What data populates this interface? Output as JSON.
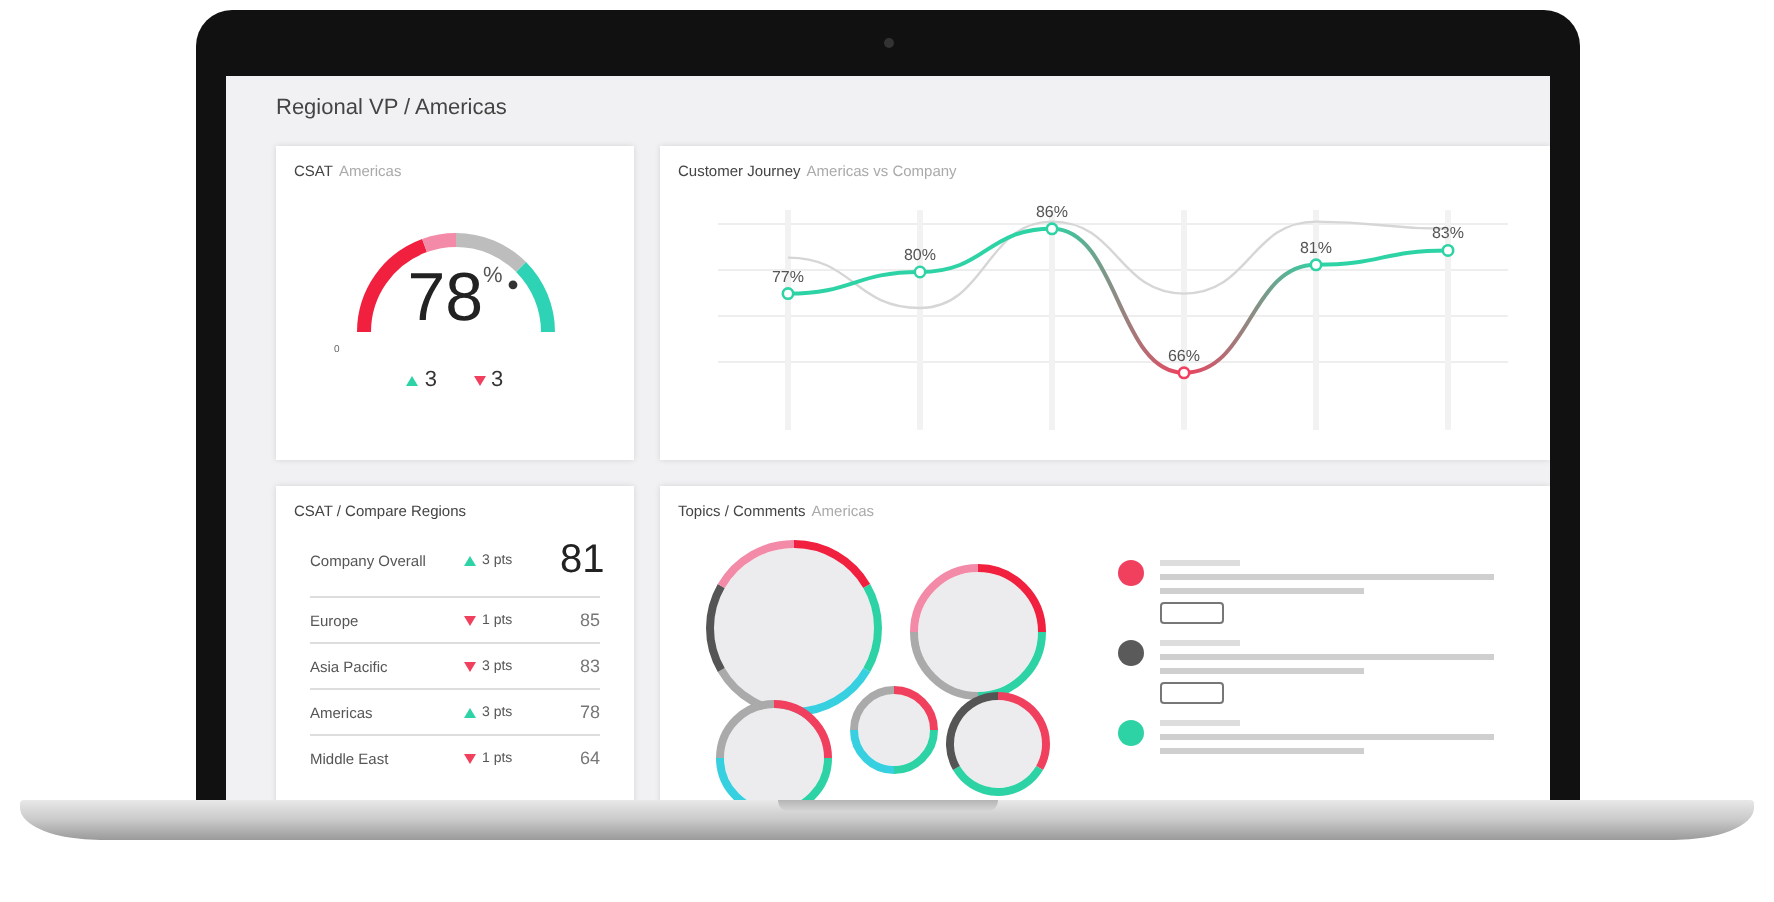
{
  "page_title": "Regional VP / Americas",
  "csat": {
    "title": "CSAT",
    "subtitle": "Americas",
    "value": "78",
    "unit": "%",
    "level": 0.78,
    "scale_min": "0",
    "deltas": [
      {
        "kind": "up",
        "value": "3"
      },
      {
        "kind": "down",
        "value": "3"
      }
    ]
  },
  "journey": {
    "title": "Customer Journey",
    "subtitle": "Americas vs Company",
    "chart_data": {
      "type": "line",
      "series": [
        {
          "color": "#2ed3a5",
          "marker": "circle",
          "values": [
            77,
            80,
            86,
            66,
            81,
            83
          ],
          "value_labels": [
            "77%",
            "80%",
            "86%",
            "66%",
            "81%",
            "83%"
          ]
        }
      ],
      "grid": true
    }
  },
  "regions": {
    "title": "CSAT / Compare Regions",
    "rows": [
      {
        "name": "Company Overall",
        "kind": "up",
        "delta": "3 pts",
        "score": "81"
      },
      {
        "name": "Europe",
        "kind": "down",
        "delta": "1 pts",
        "score": "85"
      },
      {
        "name": "Asia Pacific",
        "kind": "down",
        "delta": "3 pts",
        "score": "83"
      },
      {
        "name": "Americas",
        "kind": "up",
        "delta": "3 pts",
        "score": "78"
      },
      {
        "name": "Middle East",
        "kind": "down",
        "delta": "1 pts",
        "score": "64"
      }
    ]
  },
  "topics": {
    "title": "Topics / Comments",
    "subtitle": "Americas",
    "comments": [
      {
        "color": "#f0405e"
      },
      {
        "color": "#5a5a5a"
      },
      {
        "color": "#2ed3a5"
      }
    ]
  }
}
